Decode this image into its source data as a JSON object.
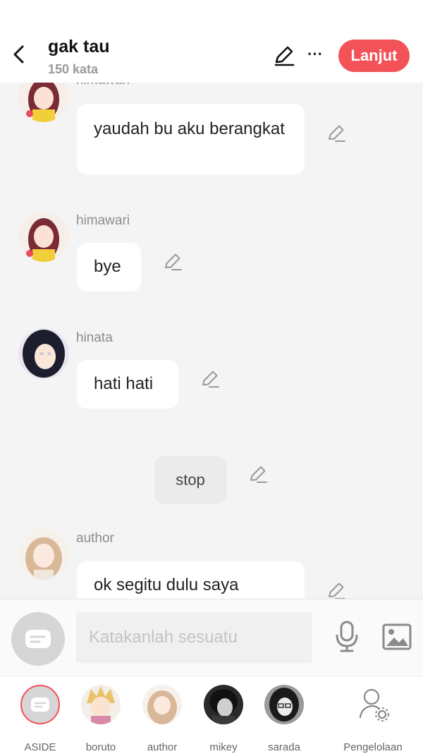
{
  "header": {
    "title": "gak tau",
    "subtitle": "150 kata",
    "next_label": "Lanjut",
    "more_label": "···"
  },
  "messages": [
    {
      "sender": "himawari",
      "text": "yaudah bu aku berangkat"
    },
    {
      "sender": "himawari",
      "text": "bye"
    },
    {
      "sender": "hinata",
      "text": "hati hati"
    },
    {
      "narration": "stop"
    },
    {
      "sender": "author",
      "text": "ok segitu dulu saya"
    }
  ],
  "composer": {
    "placeholder": "Katakanlah sesuatu"
  },
  "characters": [
    {
      "label": "ASIDE"
    },
    {
      "label": "boruto"
    },
    {
      "label": "author"
    },
    {
      "label": "mikey"
    },
    {
      "label": "sarada"
    },
    {
      "label": "Pengelolaan"
    }
  ],
  "colors": {
    "accent": "#f25258",
    "background": "#f4f4f4",
    "bubble": "#ffffff",
    "muted_text": "#8d8d8d"
  }
}
